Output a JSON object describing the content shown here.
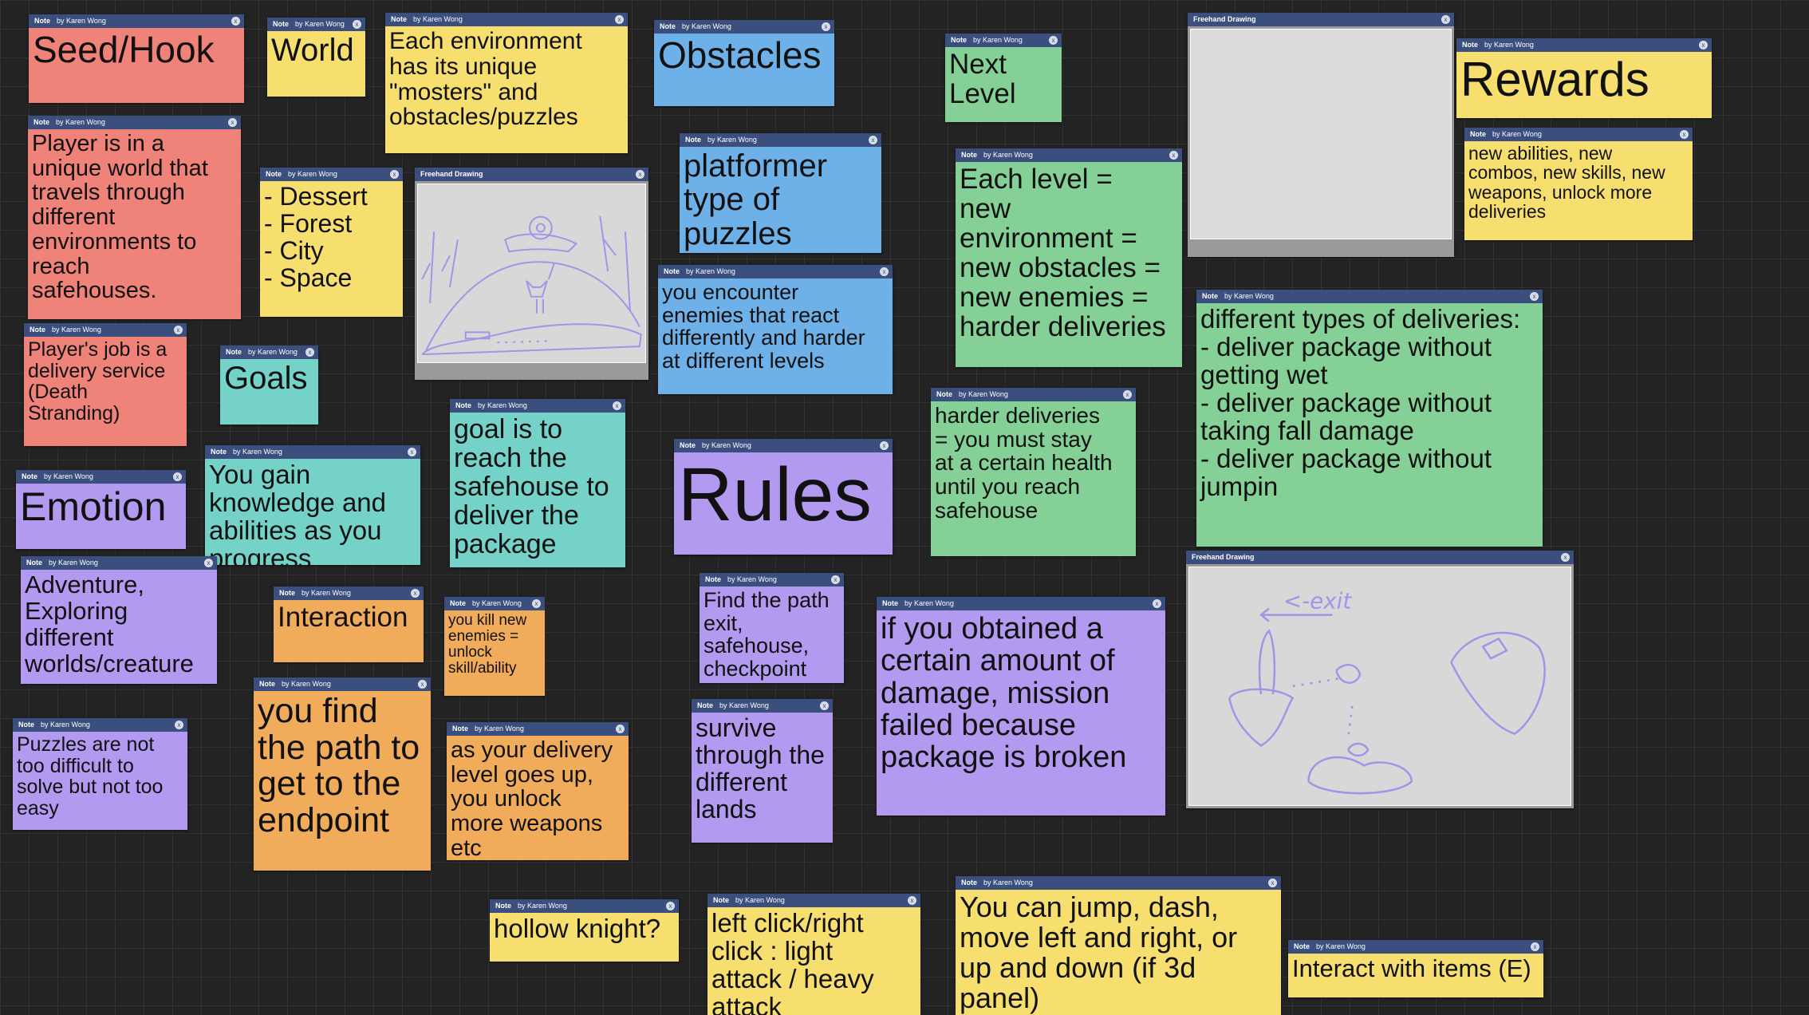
{
  "header": {
    "note_type": "Note",
    "drawing_type": "Freehand Drawing",
    "author": "by Karen Wong",
    "close": "x"
  },
  "notes": {
    "seed_hook": "Seed/Hook",
    "world": "World",
    "environment": "Each environment\nhas its unique\n\"mosters\" and\nobstacles/puzzles",
    "obstacles": "Obstacles",
    "next_level": "Next\nLevel",
    "rewards": "Rewards",
    "player_world": "Player is in a\nunique world that\ntravels through\ndifferent\nenvironments to\nreach\nsafehouses.",
    "environments_list": "- Dessert\n- Forest\n- City\n- Space",
    "platformer": "platformer\ntype of\npuzzles",
    "each_level": "Each level =\nnew\nenvironment =\nnew obstacles =\nnew enemies =\nharder deliveries",
    "new_abilities": "new abilities, new\ncombos, new skills, new\nweapons, unlock more\ndeliveries",
    "encounter_enemies": "you encounter\nenemies that react\ndifferently and harder\nat different levels",
    "player_job": "Player's job is a\ndelivery service\n(Death\nStranding)",
    "goals": "Goals",
    "delivery_types": "different types of deliveries:\n- deliver package without\ngetting wet\n- deliver package without\ntaking fall damage\n- deliver package without\njumpin",
    "goal_reach": "goal is to\nreach the\nsafehouse to\ndeliver the\npackage",
    "harder_deliveries": "harder deliveries\n= you must stay\nat a certain health\nuntil you reach\nsafehouse",
    "rules": "Rules",
    "emotion": "Emotion",
    "gain_knowledge": "You gain\nknowledge and\nabilities as you\nprogress",
    "adventure": "Adventure,\nExploring\ndifferent\nworlds/creature",
    "interaction": "Interaction",
    "kill_enemies": "you kill new\nenemies =\nunlock\nskill/ability",
    "find_path": "Find the path\nexit,\nsafehouse,\ncheckpoint",
    "damage": "if you obtained a\ncertain amount of\ndamage, mission\nfailed because\npackage is broken",
    "find_endpoint": "you find\nthe path to\nget to the\nendpoint",
    "puzzles_difficulty": "Puzzles are not\ntoo difficult to\nsolve but not too\neasy",
    "delivery_level": "as your delivery\nlevel goes up,\nyou unlock\nmore weapons\netc",
    "survive": "survive\nthrough the\ndifferent\nlands",
    "hollow_knight": "hollow knight?",
    "controls_click": "left click/right\nclick : light\nattack / heavy\nattack",
    "movement": "You can jump, dash,\nmove left and right, or\nup and down (if 3d\npanel)",
    "interact_items": "Interact with items (E)"
  },
  "drawings": {
    "drawing2_text": "<-exit"
  },
  "colors": {
    "red": "#ef8279",
    "yellow": "#f6df6f",
    "blue": "#6eb1e9",
    "green": "#84d096",
    "teal": "#74d2c8",
    "purple": "#b19af0",
    "orange": "#f0ab5b",
    "header": "#3a4f7e",
    "canvas_bg": "#232323",
    "sketch_ink": "#a493e6"
  }
}
